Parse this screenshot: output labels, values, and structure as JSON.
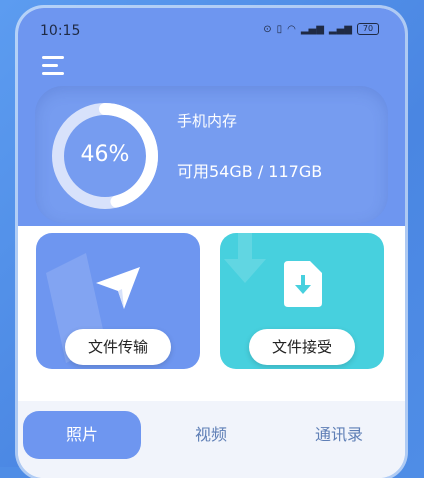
{
  "status_bar": {
    "time": "10:15",
    "icons": [
      "nfc-icon",
      "vibrate-icon",
      "wifi-icon",
      "signal-5g-icon",
      "signal-4g-icon"
    ],
    "battery": "70"
  },
  "menu": {
    "icon": "hamburger-menu-icon"
  },
  "storage": {
    "percent_label": "46%",
    "percent": 0.46,
    "title": "手机内存",
    "usage": "可用54GB / 117GB"
  },
  "actions": {
    "send_label": "文件传输",
    "receive_label": "文件接受"
  },
  "tabs": [
    {
      "label": "照片",
      "active": true
    },
    {
      "label": "视频",
      "active": false
    },
    {
      "label": "通讯录",
      "active": false
    }
  ],
  "colors": {
    "primary": "#6e96f0",
    "teal": "#47d0de",
    "frame": "#4f8de6"
  }
}
